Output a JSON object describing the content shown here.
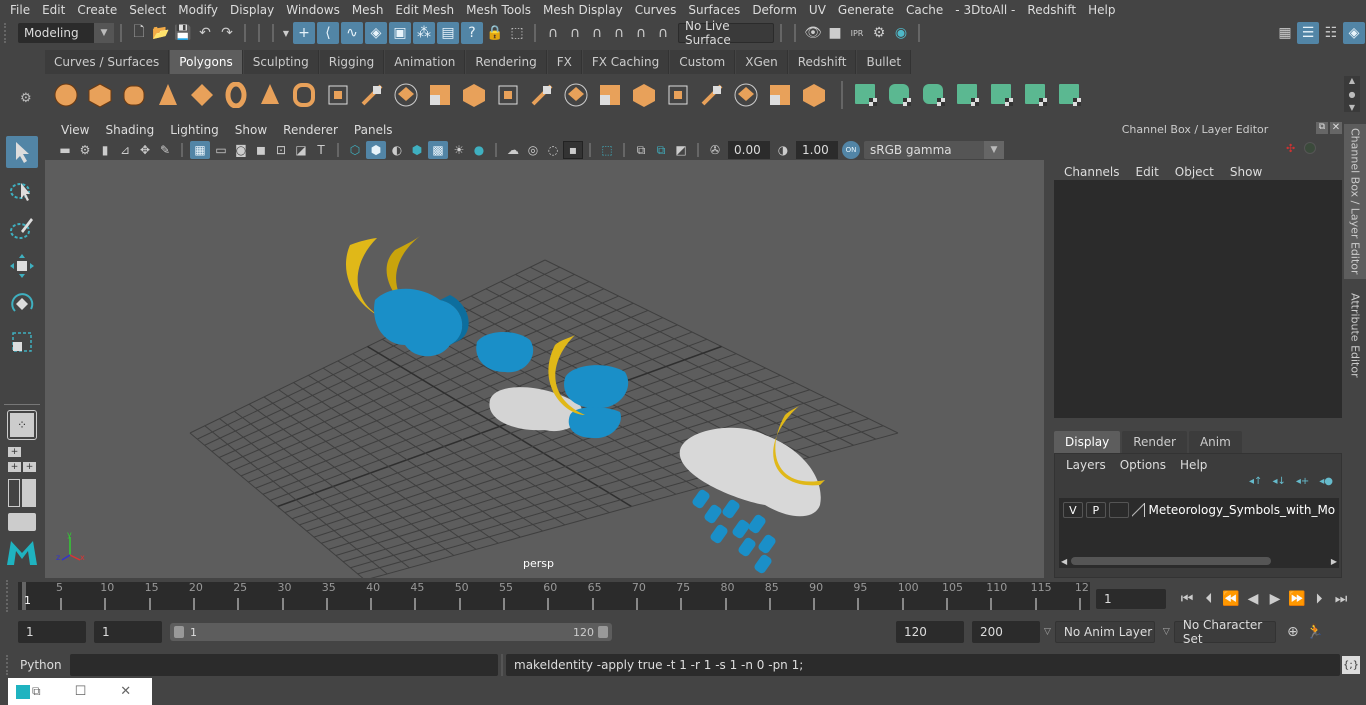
{
  "menubar": [
    "File",
    "Edit",
    "Create",
    "Select",
    "Modify",
    "Display",
    "Windows",
    "Mesh",
    "Edit Mesh",
    "Mesh Tools",
    "Mesh Display",
    "Curves",
    "Surfaces",
    "Deform",
    "UV",
    "Generate",
    "Cache",
    "- 3DtoAll -",
    "Redshift",
    "Help"
  ],
  "statusline": {
    "menuset": "Modeling",
    "live_surface": "No Live Surface"
  },
  "shelf_tabs": [
    "Curves / Surfaces",
    "Polygons",
    "Sculpting",
    "Rigging",
    "Animation",
    "Rendering",
    "FX",
    "FX Caching",
    "Custom",
    "XGen",
    "Redshift",
    "Bullet"
  ],
  "active_shelf_tab": "Polygons",
  "shelf_icons_orange": [
    "poly-sphere",
    "poly-cube",
    "poly-cylinder",
    "poly-cone",
    "poly-plane",
    "poly-torus",
    "poly-pyramid",
    "poly-pipe",
    "combine",
    "separate",
    "mirror",
    "smooth",
    "extract",
    "bevel",
    "bridge",
    "multi-cut",
    "extrude",
    "append",
    "fill-hole",
    "insert-edge-loop",
    "offset-edge-loop",
    "target-weld",
    "merge-center"
  ],
  "shelf_icons_green": [
    "uv-planar",
    "uv-cylindrical",
    "uv-spherical",
    "uv-automatic",
    "uv-unfold",
    "uv-editor",
    "uv-layout"
  ],
  "viewport": {
    "menus": [
      "View",
      "Shading",
      "Lighting",
      "Show",
      "Renderer",
      "Panels"
    ],
    "exposure": "0.00",
    "gamma": "1.00",
    "color_space": "sRGB gamma",
    "camera_label": "persp"
  },
  "channel_box": {
    "title": "Channel Box / Layer Editor",
    "menus": [
      "Channels",
      "Edit",
      "Object",
      "Show"
    ],
    "layer_tabs": [
      "Display",
      "Render",
      "Anim"
    ],
    "active_layer_tab": "Display",
    "layer_menus": [
      "Layers",
      "Options",
      "Help"
    ],
    "layers": [
      {
        "v": "V",
        "p": "P",
        "name": "Meteorology_Symbols_with_Moon_S"
      }
    ]
  },
  "side_tabs": [
    "Channel Box / Layer Editor",
    "Attribute Editor"
  ],
  "timeline": {
    "ticks": [
      "5",
      "10",
      "15",
      "20",
      "25",
      "30",
      "35",
      "40",
      "45",
      "50",
      "55",
      "60",
      "65",
      "70",
      "75",
      "80",
      "85",
      "90",
      "95",
      "100",
      "105",
      "110",
      "115",
      "12"
    ],
    "current_frame_marker": "1",
    "current_frame": "1"
  },
  "range": {
    "start": "1",
    "playback_start": "1",
    "slider_start": "1",
    "slider_end": "120",
    "playback_end": "120",
    "end": "200",
    "anim_layer": "No Anim Layer",
    "character_set": "No Character Set"
  },
  "cmdline": {
    "language": "Python",
    "input": "",
    "result": "makeIdentity -apply true -t 1 -r 1 -s 1 -n 0 -pn 1;"
  },
  "colors": {
    "accent_blue": "#5285a6",
    "shelf_orange": "#e8a15a",
    "shelf_green": "#5bb891",
    "moon_yellow": "#d4b010",
    "cloud_blue": "#1a8fc8",
    "cloud_white": "#d8d8d8"
  }
}
